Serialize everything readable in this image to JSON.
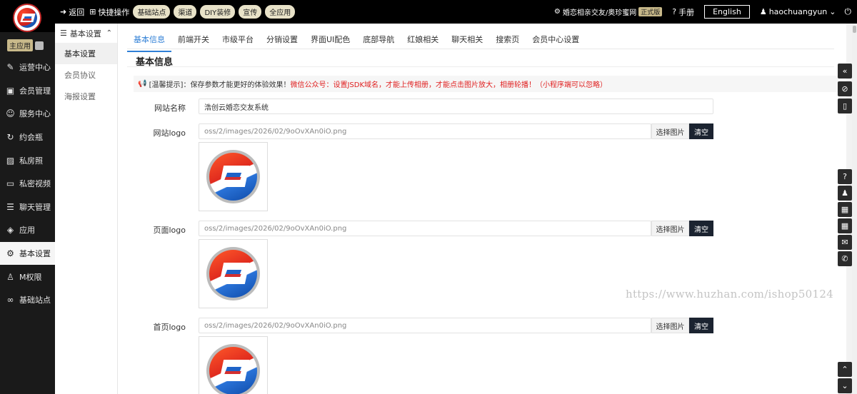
{
  "sidebar": {
    "main_app_label": "主应用",
    "items": [
      {
        "label": "运营中心",
        "icon": "edit-icon"
      },
      {
        "label": "会员管理",
        "icon": "id-card-icon"
      },
      {
        "label": "服务中心",
        "icon": "user-service-icon"
      },
      {
        "label": "约会瓶",
        "icon": "bottle-icon"
      },
      {
        "label": "私房照",
        "icon": "photo-icon"
      },
      {
        "label": "私密视频",
        "icon": "video-icon"
      },
      {
        "label": "聊天管理",
        "icon": "chat-icon"
      },
      {
        "label": "应用",
        "icon": "cube-icon"
      },
      {
        "label": "基本设置",
        "icon": "gear-icon"
      },
      {
        "label": "M权限",
        "icon": "user-icon"
      },
      {
        "label": "基础站点",
        "icon": "infinity-icon"
      }
    ]
  },
  "topbar": {
    "back": "返回",
    "quick": "快捷操作",
    "pills": [
      "基础站点",
      "渠道",
      "DIY装修",
      "宣传",
      "全应用"
    ],
    "site_name": "婚恋相亲交友/奥珍蜜网",
    "site_badge": "正式版",
    "manual": "手册",
    "language": "English",
    "username": "haochuangyun"
  },
  "subside": {
    "title": "基本设置",
    "items": [
      "基本设置",
      "会员协议",
      "海报设置"
    ]
  },
  "tabs": [
    "基本信息",
    "前端开关",
    "市级平台",
    "分销设置",
    "界面UI配色",
    "底部导航",
    "红娘相关",
    "聊天相关",
    "搜索页",
    "会员中心设置"
  ],
  "section_title": "基本信息",
  "notice": {
    "prefix": "[温馨提示]：保存参数才能更好的体验效果！",
    "warning": "微信公众号：设置JSDK域名，才能上传相册，才能点击图片放大，相册轮播！（小程序端可以忽略）"
  },
  "form": {
    "site_name_label": "网站名称",
    "site_name_value": "浩创云婚恋交友系统",
    "logo_rows": [
      {
        "label": "网站logo",
        "path": "oss/2/images/2026/02/9oOvXAn0iO.png"
      },
      {
        "label": "页面logo",
        "path": "oss/2/images/2026/02/9oOvXAn0iO.png"
      },
      {
        "label": "首页logo",
        "path": "oss/2/images/2026/02/9oOvXAn0iO.png"
      }
    ],
    "pick_label": "选择图片",
    "clear_label": "清空"
  },
  "watermark": "https://www.huzhan.com/ishop50124",
  "colors": {
    "accent": "#2f7fd6",
    "warning": "#e02020",
    "dark": "#1a1a1a"
  }
}
